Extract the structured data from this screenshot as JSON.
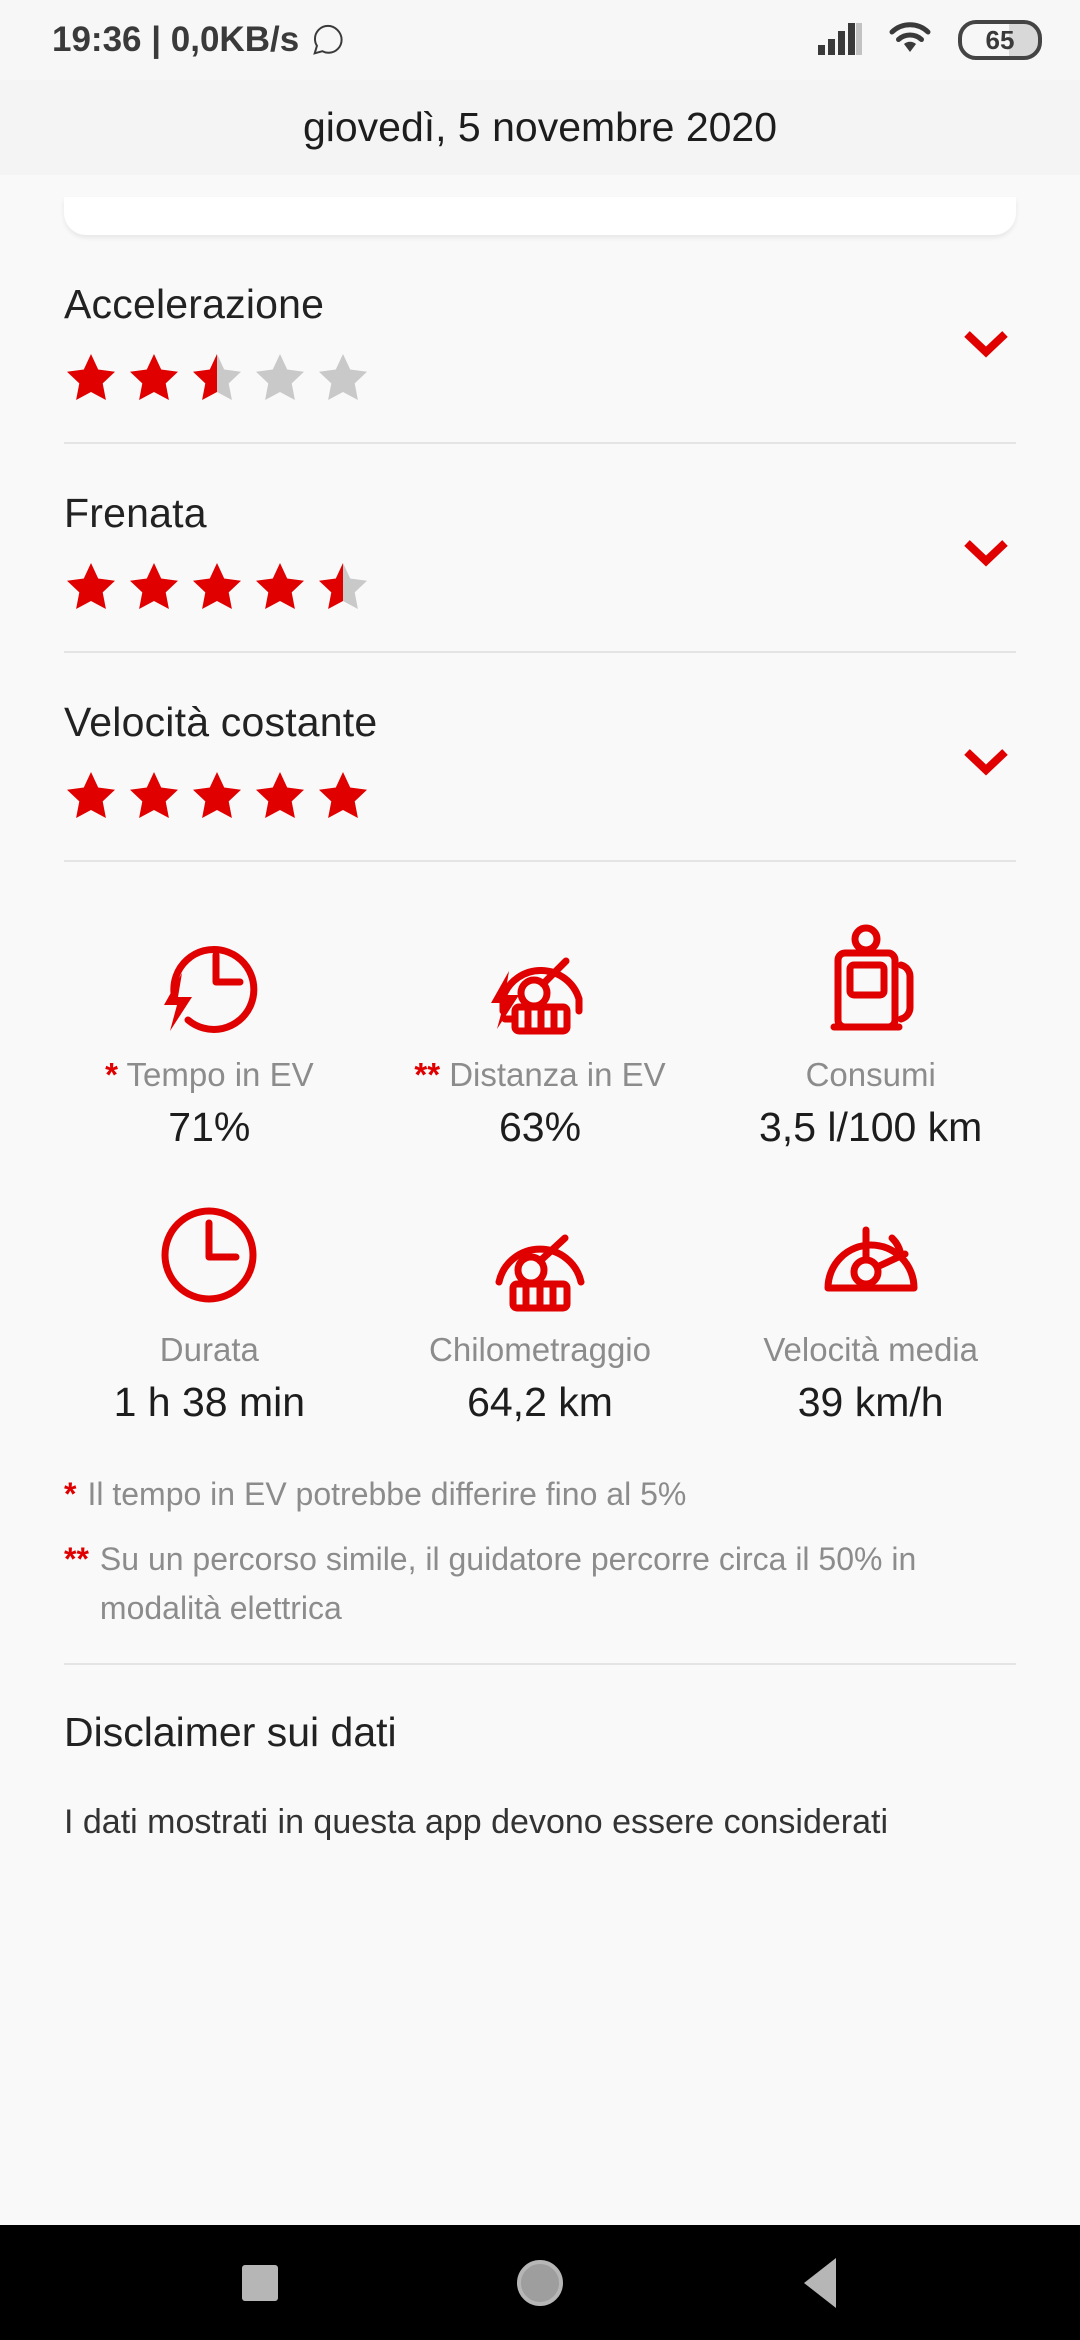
{
  "statusbar": {
    "clock_text": "19:36 | 0,0KB/s",
    "whatsapp_icon": "whatsapp-icon",
    "signal_icon": "signal-bars-icon",
    "wifi_icon": "wifi-icon",
    "battery_level": "65"
  },
  "header": {
    "title": "giovedì, 5 novembre 2020"
  },
  "ratings": [
    {
      "label": "Accelerazione",
      "value": 2.5,
      "expand_icon": "chevron-down-icon"
    },
    {
      "label": "Frenata",
      "value": 4.5,
      "expand_icon": "chevron-down-icon"
    },
    {
      "label": "Velocità costante",
      "value": 5.0,
      "expand_icon": "chevron-down-icon"
    }
  ],
  "metrics_row1": [
    {
      "icon": "ev-time-icon",
      "marker": "*",
      "label": "Tempo in EV",
      "value": "71%"
    },
    {
      "icon": "ev-distance-icon",
      "marker": "**",
      "label": "Distanza in EV",
      "value": "63%"
    },
    {
      "icon": "fuel-pump-icon",
      "marker": "",
      "label": "Consumi",
      "value": "3,5 l/100 km"
    }
  ],
  "metrics_row2": [
    {
      "icon": "clock-icon",
      "marker": "",
      "label": "Durata",
      "value": "1 h 38 min"
    },
    {
      "icon": "odometer-icon",
      "marker": "",
      "label": "Chilometraggio",
      "value": "64,2 km"
    },
    {
      "icon": "speedometer-icon",
      "marker": "",
      "label": "Velocità media",
      "value": "39 km/h"
    }
  ],
  "footnotes": [
    {
      "mark": "*",
      "text": "Il tempo in EV potrebbe differire fino al 5%"
    },
    {
      "mark": "**",
      "text": "Su un percorso simile, il guidatore percorre circa il 50%  in modalità elettrica"
    }
  ],
  "disclaimer": {
    "title": "Disclaimer sui dati",
    "body": "I dati mostrati in questa app devono essere considerati"
  },
  "navbar": {
    "recents_icon": "square-recents-icon",
    "home_icon": "circle-home-icon",
    "back_icon": "triangle-back-icon"
  },
  "colors": {
    "accent_red": "#e00000",
    "star_empty": "#c9c9c9",
    "label_grey": "#8c8c8c",
    "background": "#f9f9f9"
  }
}
